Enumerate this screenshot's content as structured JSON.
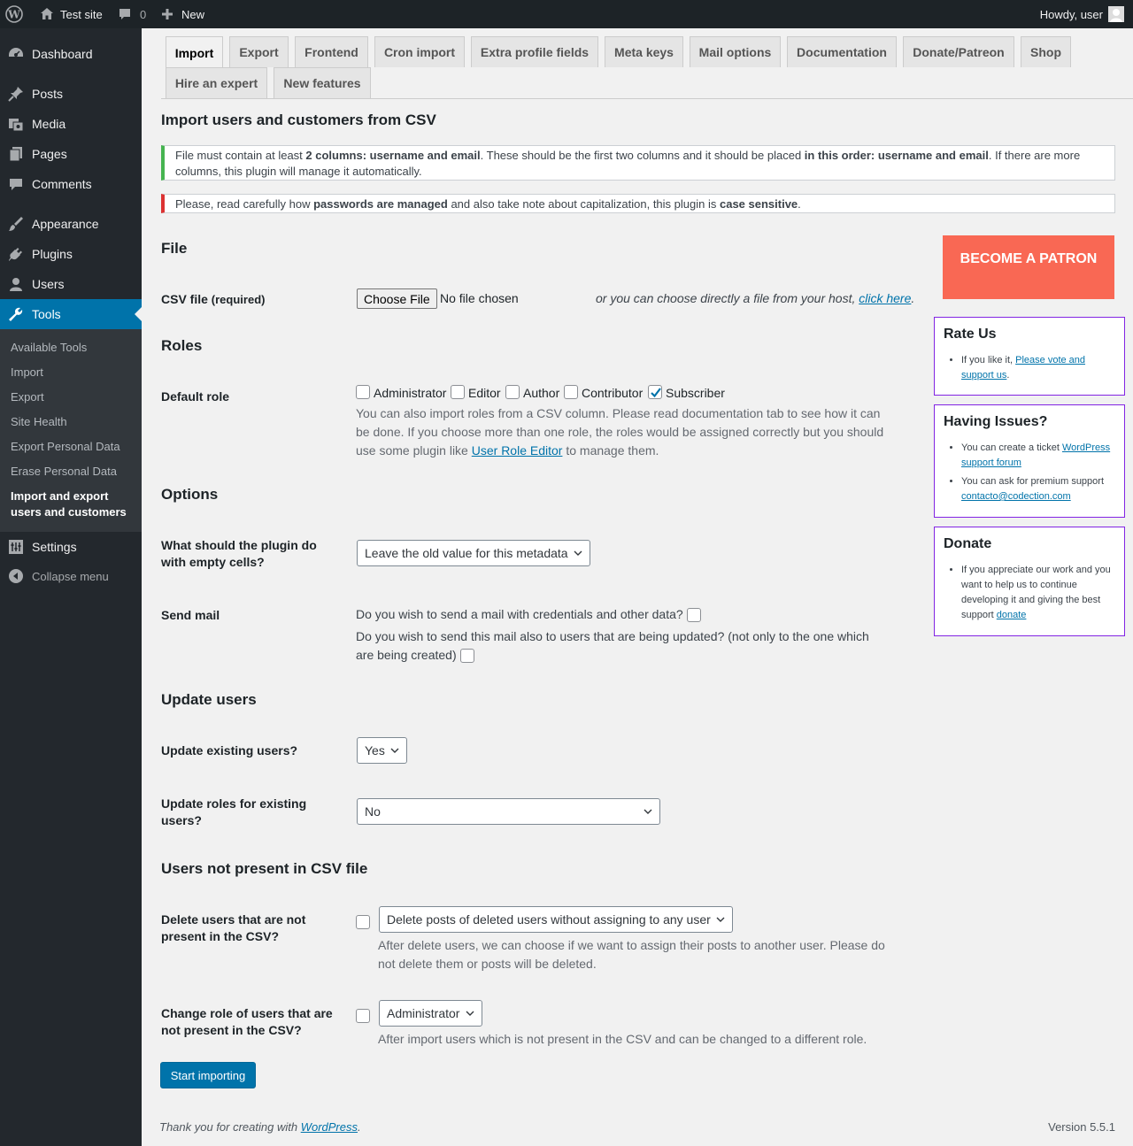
{
  "adminbar": {
    "site_name": "Test site",
    "comments_count": "0",
    "new_label": "New",
    "howdy": "Howdy, user"
  },
  "sidebar": {
    "items": [
      {
        "label": "Dashboard",
        "icon": "dashboard-icon"
      },
      {
        "label": "Posts",
        "icon": "pin-icon"
      },
      {
        "label": "Media",
        "icon": "media-icon"
      },
      {
        "label": "Pages",
        "icon": "pages-icon"
      },
      {
        "label": "Comments",
        "icon": "comment-icon"
      },
      {
        "label": "Appearance",
        "icon": "brush-icon"
      },
      {
        "label": "Plugins",
        "icon": "plug-icon"
      },
      {
        "label": "Users",
        "icon": "user-icon"
      },
      {
        "label": "Tools",
        "icon": "wrench-icon"
      },
      {
        "label": "Settings",
        "icon": "settings-icon"
      },
      {
        "label": "Collapse menu",
        "icon": "collapse-icon"
      }
    ],
    "submenu": [
      "Available Tools",
      "Import",
      "Export",
      "Site Health",
      "Export Personal Data",
      "Erase Personal Data",
      "Import and export users and customers"
    ]
  },
  "tabs": [
    "Import",
    "Export",
    "Frontend",
    "Cron import",
    "Extra profile fields",
    "Meta keys",
    "Mail options",
    "Documentation",
    "Donate/Patreon",
    "Shop",
    "Hire an expert",
    "New features"
  ],
  "page": {
    "title": "Import users and customers from CSV",
    "notice1": {
      "t1": "File must contain at least ",
      "b1": "2 columns: username and email",
      "t2": ". These should be the first two columns and it should be placed ",
      "b2": "in this order: username and email",
      "t3": ". If there are more columns, this plugin will manage it automatically."
    },
    "notice2": {
      "t1": "Please, read carefully how ",
      "b1": "passwords are managed",
      "t2": " and also take note about capitalization, this plugin is ",
      "b2": "case sensitive",
      "t3": "."
    }
  },
  "file_section": {
    "heading": "File",
    "csv_label": "CSV file",
    "csv_required": "(required)",
    "choose_file": "Choose File",
    "no_file": "No file chosen",
    "host_text": "or you can choose directly a file from your host,",
    "host_link": "click here",
    "host_period": "."
  },
  "roles_section": {
    "heading": "Roles",
    "default_role_label": "Default role",
    "roles": [
      {
        "name": "Administrator",
        "checked": false
      },
      {
        "name": "Editor",
        "checked": false
      },
      {
        "name": "Author",
        "checked": false
      },
      {
        "name": "Contributor",
        "checked": false
      },
      {
        "name": "Subscriber",
        "checked": true
      }
    ],
    "desc_before": "You can also import roles from a CSV column. Please read documentation tab to see how it can be done. If you choose more than one role, the roles would be assigned correctly but you should use some plugin like ",
    "desc_link": "User Role Editor",
    "desc_after": " to manage them."
  },
  "options_section": {
    "heading": "Options",
    "empty_cells_label": "What should the plugin do with empty cells?",
    "empty_cells_value": "Leave the old value for this metadata",
    "send_mail_label": "Send mail",
    "send_mail_q1": "Do you wish to send a mail with credentials and other data?",
    "send_mail_q2": "Do you wish to send this mail also to users that are being updated? (not only to the one which are being created)"
  },
  "update_section": {
    "heading": "Update users",
    "update_existing_label": "Update existing users?",
    "update_existing_value": "Yes",
    "update_roles_label": "Update roles for existing users?",
    "update_roles_value": "No"
  },
  "not_present_section": {
    "heading": "Users not present in CSV file",
    "delete_label": "Delete users that are not present in the CSV?",
    "delete_value": "Delete posts of deleted users without assigning to any user",
    "delete_desc": "After delete users, we can choose if we want to assign their posts to another user. Please do not delete them or posts will be deleted.",
    "change_role_label": "Change role of users that are not present in the CSV?",
    "change_role_value": "Administrator",
    "change_role_desc": "After import users which is not present in the CSV and can be changed to a different role."
  },
  "start_button": "Start importing",
  "right": {
    "patron": "BECOME A PATRON",
    "rate": {
      "title": "Rate Us",
      "text": "If you like it, ",
      "link": "Please vote and support us",
      "end": "."
    },
    "issues": {
      "title": "Having Issues?",
      "item1_text": "You can create a ticket ",
      "item1_link": "WordPress support forum",
      "item2_text": "You can ask for premium support ",
      "item2_link": "contacto@codection.com"
    },
    "donate": {
      "title": "Donate",
      "text": "If you appreciate our work and you want to help us to continue developing it and giving the best support ",
      "link": "donate"
    }
  },
  "footer": {
    "thanks": "Thank you for creating with ",
    "wp_link": "WordPress",
    "period": ".",
    "version": "Version 5.5.1"
  },
  "colors": {
    "accent": "#0073aa",
    "patron": "#f96854",
    "box_border": "#8224e3",
    "sidebar": "#23282d"
  }
}
